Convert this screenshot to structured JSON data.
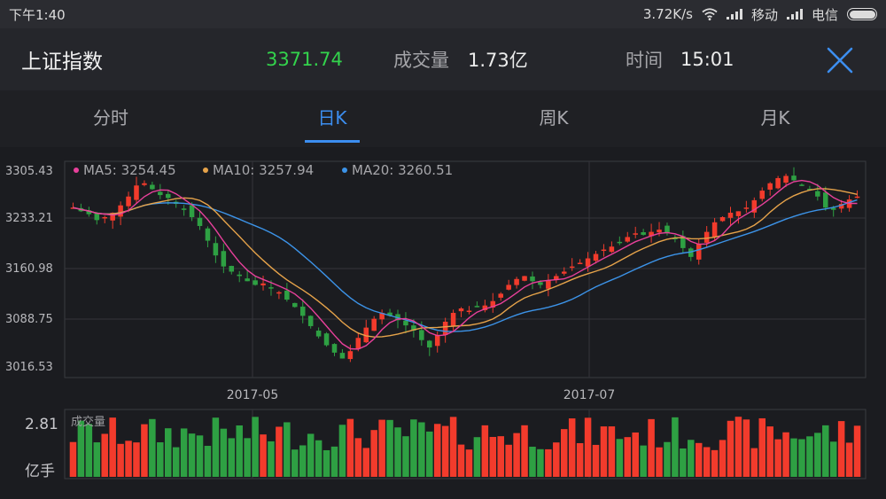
{
  "status_bar": {
    "time": "下午1:40",
    "speed": "3.72K/s",
    "carrier1": "移动",
    "carrier2": "电信"
  },
  "header": {
    "index_name": "上证指数",
    "price": "3371.74",
    "volume_label": "成交量",
    "volume_value": "1.73亿",
    "time_label": "时间",
    "time_value": "15:01"
  },
  "tabs": [
    {
      "label": "分时",
      "active": false
    },
    {
      "label": "日K",
      "active": true
    },
    {
      "label": "周K",
      "active": false
    },
    {
      "label": "月K",
      "active": false
    }
  ],
  "colors": {
    "up": "#f23b2c",
    "down": "#2ea043",
    "ma5": "#e8409b",
    "ma10": "#e6a34a",
    "ma20": "#3c93e8",
    "accent": "#3c8ef0",
    "price": "#33d34c"
  },
  "icons": {
    "close": "close-icon",
    "wifi": "wifi-icon",
    "signal": "signal-icon",
    "battery": "battery-icon"
  },
  "chart_data": {
    "type": "candlestick",
    "legend": [
      {
        "name": "MA5",
        "value": "3254.45"
      },
      {
        "name": "MA10",
        "value": "3257.94"
      },
      {
        "name": "MA20",
        "value": "3260.51"
      }
    ],
    "y_ticks": [
      "3305.43",
      "3233.21",
      "3160.98",
      "3088.75",
      "3016.53"
    ],
    "y_range": [
      3016.53,
      3305.43
    ],
    "x_ticks": [
      "2017-05",
      "2017-07"
    ],
    "volume_label": "成交量",
    "volume_tick": "2.81",
    "volume_unit": "亿手",
    "close_path": [
      3245,
      3240,
      3236,
      3228,
      3232,
      3238,
      3248,
      3260,
      3275,
      3278,
      3270,
      3262,
      3258,
      3250,
      3242,
      3232,
      3220,
      3200,
      3180,
      3165,
      3158,
      3152,
      3145,
      3140,
      3142,
      3136,
      3130,
      3120,
      3110,
      3098,
      3084,
      3070,
      3058,
      3048,
      3040,
      3050,
      3068,
      3082,
      3094,
      3102,
      3098,
      3092,
      3085,
      3078,
      3065,
      3055,
      3072,
      3090,
      3102,
      3108,
      3105,
      3110,
      3112,
      3118,
      3128,
      3140,
      3148,
      3152,
      3145,
      3140,
      3146,
      3152,
      3158,
      3165,
      3170,
      3176,
      3182,
      3188,
      3192,
      3198,
      3205,
      3210,
      3208,
      3212,
      3215,
      3210,
      3202,
      3190,
      3178,
      3196,
      3212,
      3225,
      3232,
      3238,
      3240,
      3245,
      3255,
      3268,
      3278,
      3285,
      3288,
      3282,
      3276,
      3270,
      3260,
      3245,
      3242,
      3250,
      3256,
      3260
    ]
  }
}
